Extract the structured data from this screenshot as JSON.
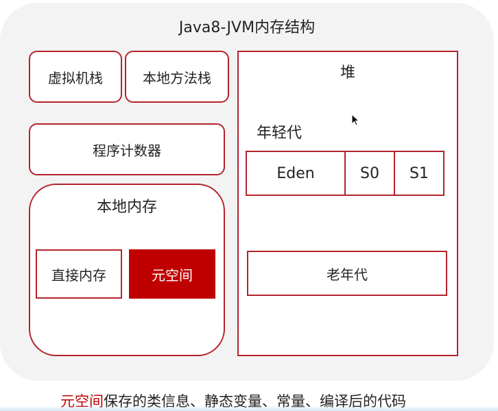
{
  "title": "Java8-JVM内存结构",
  "colors": {
    "accent": "#c00000",
    "border": "#b3232b",
    "panel": "#f3f3f3"
  },
  "left": {
    "vm_stack": "虚拟机栈",
    "native_method_stack": "本地方法栈",
    "program_counter": "程序计数器",
    "native_memory": {
      "label": "本地内存",
      "direct_memory": "直接内存",
      "metaspace": "元空间"
    }
  },
  "heap": {
    "label": "堆",
    "young_gen": {
      "label": "年轻代",
      "eden": "Eden",
      "s0": "S0",
      "s1": "S1"
    },
    "old_gen": "老年代"
  },
  "caption": {
    "highlight": "元空间",
    "rest": "保存的类信息、静态变量、常量、编译后的代码"
  }
}
